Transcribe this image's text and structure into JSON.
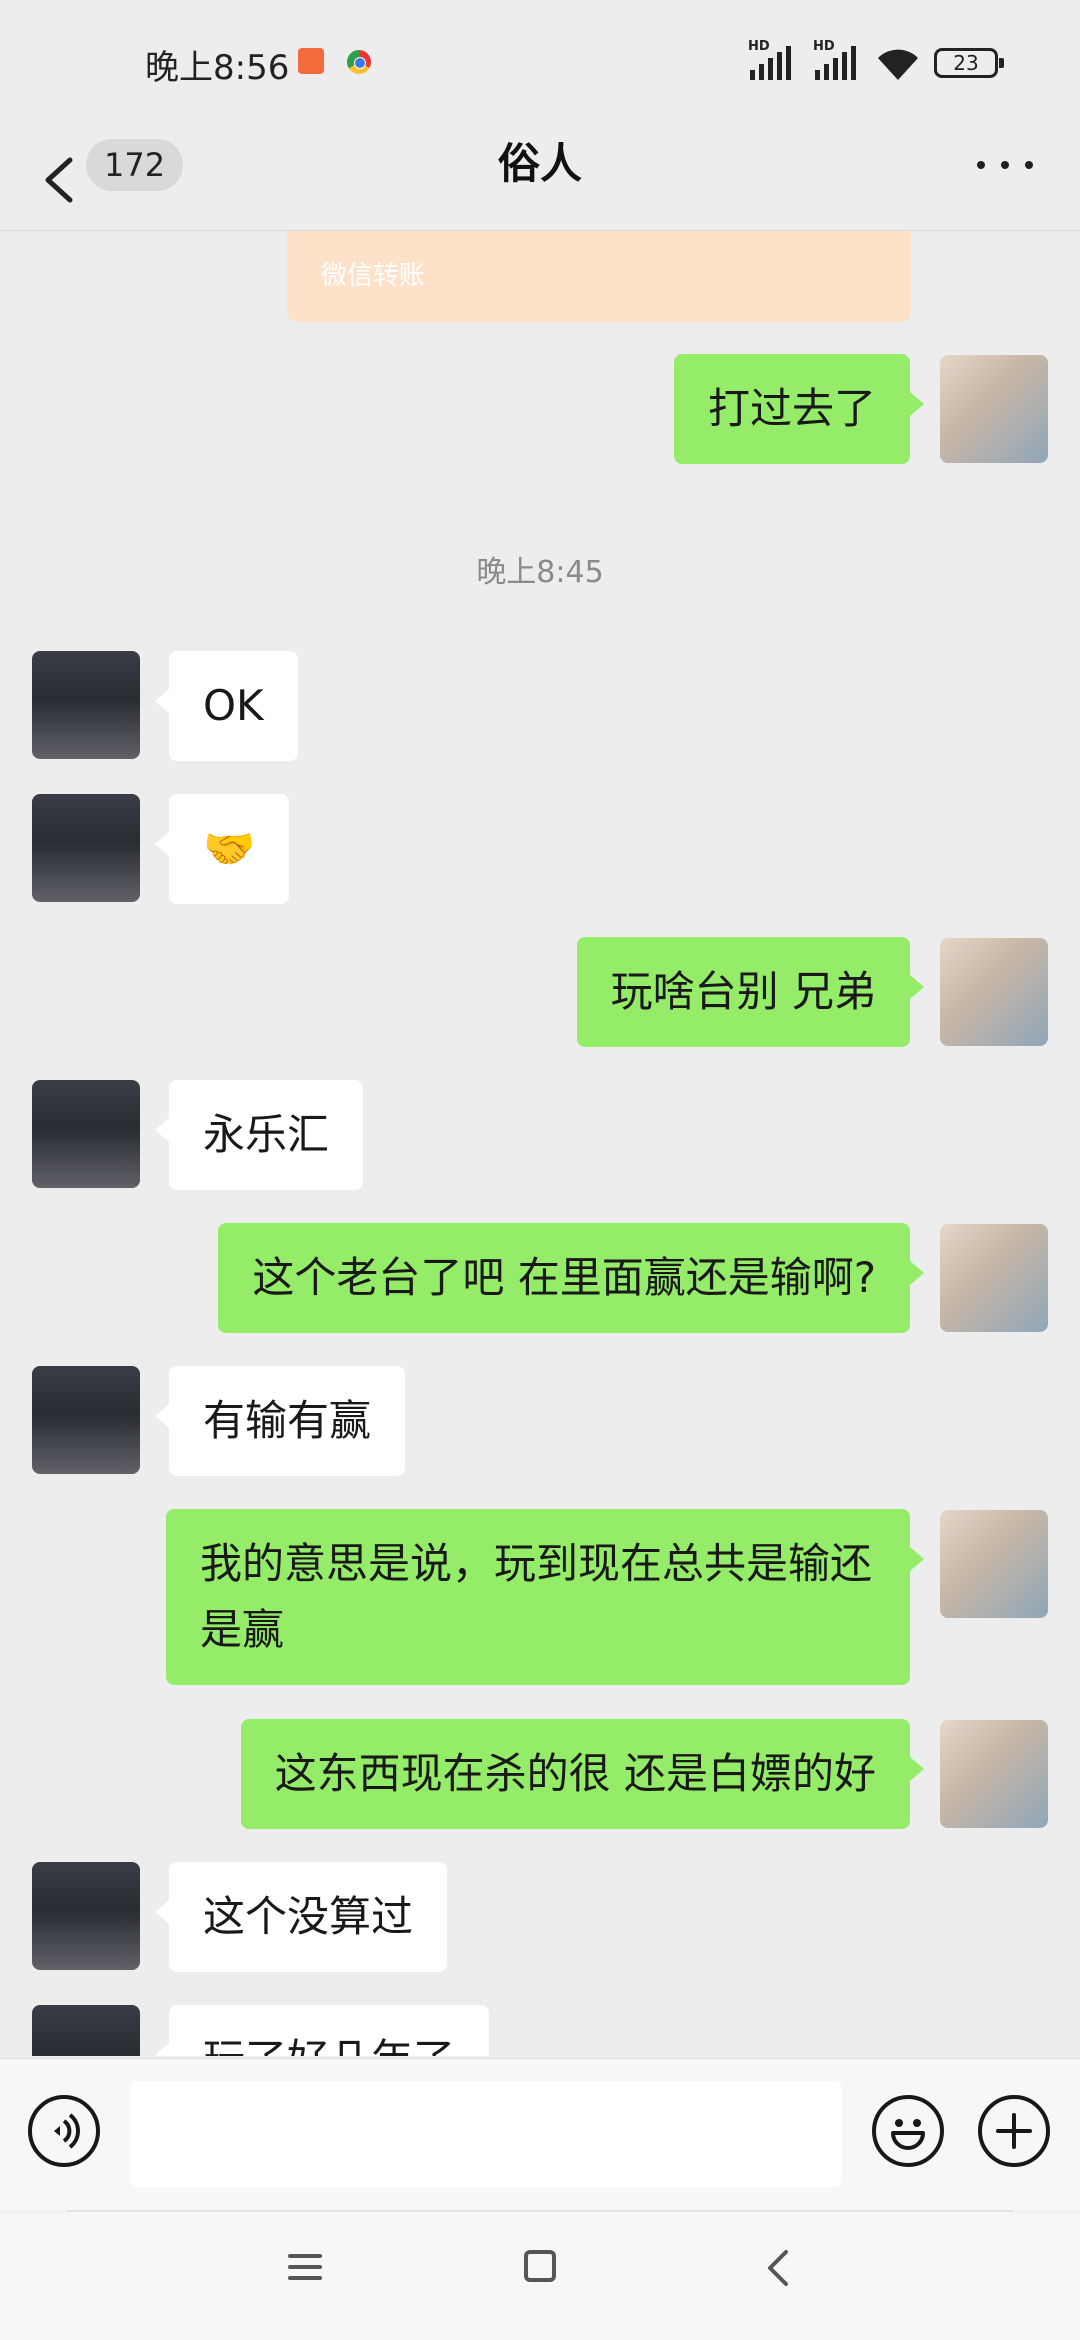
{
  "status_bar": {
    "time": "晚上8:56",
    "network_1": "HD",
    "network_2": "HD",
    "battery": "23"
  },
  "header": {
    "unread_count": "172",
    "title": "俗人"
  },
  "chat": {
    "transfer_label": "微信转账",
    "messages": [
      {
        "side": "sent",
        "text": "打过去了"
      },
      {
        "type": "timestamp",
        "text": "晚上8:45"
      },
      {
        "side": "received",
        "text": "OK"
      },
      {
        "side": "received",
        "text": "🤝"
      },
      {
        "side": "sent",
        "text": "玩啥台别 兄弟"
      },
      {
        "side": "received",
        "text": "永乐汇"
      },
      {
        "side": "sent",
        "text": "这个老台了吧 在里面赢还是输啊?"
      },
      {
        "side": "received",
        "text": "有输有赢"
      },
      {
        "side": "sent",
        "text": "我的意思是说，玩到现在总共是输还是赢"
      },
      {
        "side": "sent",
        "text": "这东西现在杀的很 还是白嫖的好"
      },
      {
        "side": "received",
        "text": "这个没算过"
      },
      {
        "side": "received",
        "text": "玩了好几年了"
      }
    ]
  },
  "input_bar": {
    "value": "",
    "placeholder": ""
  },
  "colors": {
    "sent_bubble": "#95ec69",
    "received_bubble": "#ffffff",
    "background": "#ededed"
  }
}
